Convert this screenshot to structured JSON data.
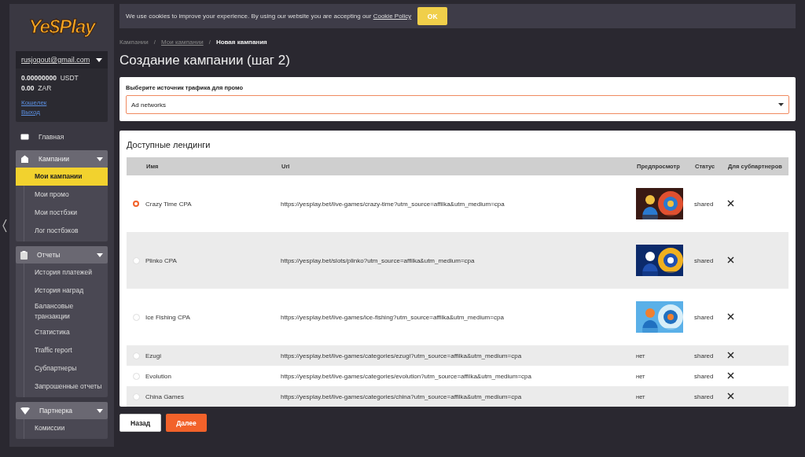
{
  "logo": "Ye$Play",
  "account": {
    "email": "rusjogout@gmail.com",
    "balances": [
      {
        "amount": "0.00000000",
        "currency": "USDT"
      },
      {
        "amount": "0.00",
        "currency": "ZAR"
      }
    ],
    "links": [
      "Кошелек",
      "Выход"
    ]
  },
  "nav": [
    {
      "kind": "link",
      "label": "Главная",
      "selected": false
    },
    {
      "kind": "group",
      "label": "Кампании",
      "expanded": true,
      "children": [
        {
          "label": "Мои кампании",
          "selected": true
        },
        {
          "label": "Мои промо",
          "selected": false
        },
        {
          "label": "Мои постбэки",
          "selected": false
        },
        {
          "label": "Лог постбэков",
          "selected": false
        }
      ]
    },
    {
      "kind": "group",
      "label": "Отчеты",
      "expanded": true,
      "children": [
        {
          "label": "История платежей",
          "selected": false
        },
        {
          "label": "История наград",
          "selected": false
        },
        {
          "label": "Балансовые транзакции",
          "selected": false
        },
        {
          "label": "Статистика",
          "selected": false
        },
        {
          "label": "Traffic report",
          "selected": false
        },
        {
          "label": "Субпартнеры",
          "selected": false
        },
        {
          "label": "Запрошенные отчеты",
          "selected": false
        }
      ]
    },
    {
      "kind": "group",
      "label": "Партнерка",
      "expanded": true,
      "children": [
        {
          "label": "Комиссии",
          "selected": false
        }
      ]
    }
  ],
  "cookie_banner": {
    "text": "We use cookies to improve your experience. By using our website you are accepting our",
    "link": "Cookie Policy",
    "button": "OK"
  },
  "breadcrumbs": [
    {
      "kind": "crumb",
      "label": "Кампании",
      "link": false
    },
    {
      "kind": "separator",
      "label": "/"
    },
    {
      "kind": "crumb",
      "label": "Мои кампании",
      "link": true
    },
    {
      "kind": "separator",
      "label": "/"
    },
    {
      "kind": "crumb",
      "label": "Новая кампания",
      "link": false
    }
  ],
  "title": "Создание кампании (шаг 2)",
  "traffic_source": {
    "label": "Выберите источник трафика для промо",
    "value": "Ad networks"
  },
  "landings": {
    "title": "Доступные лендинги",
    "columns": [
      "Имя",
      "Url",
      "Предпросмотр",
      "Статус",
      "Для субпартнеров"
    ],
    "rows": [
      {
        "selected": true,
        "name": "Crazy Time CPA",
        "url": "https://yesplay.bet/live-games/crazy-time?utm_source=affilka&utm_medium=cpa",
        "status": "shared",
        "subpartners": false
      },
      {
        "selected": false,
        "name": "Plinko CPA",
        "url": "https://yesplay.bet/slots/plinko?utm_source=affilka&utm_medium=cpa",
        "status": "shared",
        "subpartners": false
      },
      {
        "selected": false,
        "name": "Ice Fishing CPA",
        "url": "https://yesplay.bet/live-games/ice-fishing?utm_source=affilka&utm_medium=cpa",
        "status": "shared",
        "subpartners": false
      },
      {
        "selected": false,
        "name": "Ezugi",
        "url": "https://yesplay.bet/live-games/categories/ezugi?utm_source=affilka&utm_medium=cpa",
        "preview": {
          "kind": "text",
          "text": "нет"
        },
        "status": "shared",
        "subpartners": false
      },
      {
        "selected": false,
        "name": "Evolution",
        "url": "https://yesplay.bet/live-games/categories/evolution?utm_source=affilka&utm_medium=cpa",
        "preview": {
          "kind": "text",
          "text": "нет"
        },
        "status": "shared",
        "subpartners": false
      },
      {
        "selected": false,
        "name": "China Games",
        "url": "https://yesplay.bet/live-games/categories/china?utm_source=affilka&utm_medium=cpa",
        "preview": {
          "kind": "text",
          "text": "нет"
        },
        "status": "shared",
        "subpartners": false
      }
    ]
  },
  "buttons": [
    {
      "label": "Назад",
      "kind": "secondary"
    },
    {
      "label": "Далее",
      "kind": "primary"
    }
  ]
}
